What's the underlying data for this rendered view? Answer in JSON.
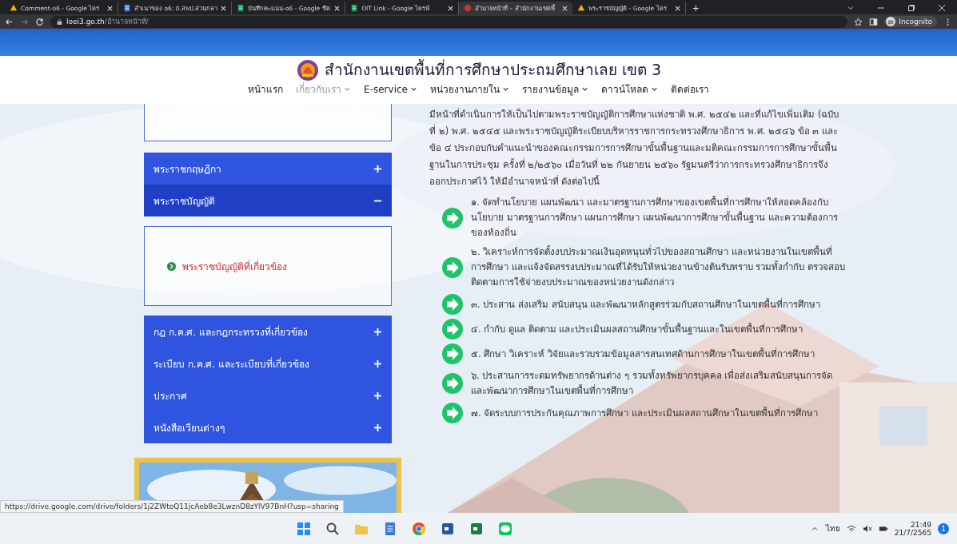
{
  "browser": {
    "tabs": [
      {
        "title": "Comment-o6 - Google ไดร",
        "kind": "drive",
        "selected": false
      },
      {
        "title": "สำเนาของ o6: 0.สพป.ส่วนกลา",
        "kind": "docs",
        "selected": false
      },
      {
        "title": "บันทึกคะแนน-o6 - Google ชีต",
        "kind": "sheets",
        "selected": false
      },
      {
        "title": "OIT Link - Google ไดรฟ์",
        "kind": "sheets",
        "selected": false
      },
      {
        "title": "อำนาจหน้าที่ – สำนักงานเขตพื้",
        "kind": "site",
        "selected": true
      },
      {
        "title": "พระราชบัญญัติ - Google ไดร",
        "kind": "drive",
        "selected": false
      }
    ],
    "new_tab": "+",
    "address": {
      "host": "loei3.go.th",
      "path": "/อำนาจหน้าที่/"
    },
    "profile": "Incognito",
    "status_url": "https://drive.google.com/drive/folders/1j2ZWtoQ11jcAeb8e3LwznD8zYlV97BnH?usp=sharing"
  },
  "site": {
    "title": "สำนักงานเขตพื้นที่การศึกษาประถมศึกษาเลย เขต 3",
    "nav": [
      {
        "label": "หน้าแรก",
        "selected": false,
        "dropdown": false
      },
      {
        "label": "เกี่ยวกับเรา",
        "selected": true,
        "dropdown": true
      },
      {
        "label": "E-service",
        "selected": false,
        "dropdown": true
      },
      {
        "label": "หน่วยงานภายใน",
        "selected": false,
        "dropdown": true
      },
      {
        "label": "รายงานข้อมูล",
        "selected": false,
        "dropdown": true
      },
      {
        "label": "ดาวน์โหลด",
        "selected": false,
        "dropdown": true
      },
      {
        "label": "ติดต่อเรา",
        "selected": false,
        "dropdown": false
      }
    ]
  },
  "sidebar": {
    "items": [
      {
        "label": "พระราชกฤษฎีกา",
        "expanded": false
      },
      {
        "label": "พระราชบัญญัติ",
        "expanded": true,
        "children": [
          {
            "label": "พระราชบัญญัติที่เกี่ยวข้อง"
          }
        ]
      },
      {
        "label": "กฎ ก.ค.ศ. และกฎกระทรวงที่เกี่ยวข้อง",
        "expanded": false
      },
      {
        "label": "ระเบียบ ก.ค.ศ. และระเบียบที่เกี่ยวข้อง",
        "expanded": false
      },
      {
        "label": "ประกาศ",
        "expanded": false
      },
      {
        "label": "หนังสือเวียนต่างๆ",
        "expanded": false
      }
    ]
  },
  "content": {
    "intro": "มีหน้าที่ดำเนินการให้เป็นไปตามพระราชบัญญัติการศึกษาแห่งชาติ พ.ศ. ๒๕๔๒ และที่แก้ไขเพิ่มเติม (ฉบับที่ ๒) พ.ศ. ๒๕๔๕ และพระราชบัญญัติระเบียบบริหารราชการกระทรวงศึกษาธิการ พ.ศ. ๒๕๔๖ ข้อ ๓ และข้อ ๔ ประกอบกับคำแนะนำของคณะกรรมการการศึกษาขั้นพื้นฐานและมติคณะกรรมการการศึกษาขั้นพื้นฐานในการประชุม ครั้งที่ ๒/๒๕๖๐ เมื่อวันที่ ๒๒ กันยายน ๒๕๖๐ รัฐมนตรีว่าการกระทรวงศึกษาธิการจึงออกประกาศไว้ ให้มีอำนาจหน้าที่ ดังต่อไปนี้",
    "duties": [
      "๑. จัดทำนโยบาย แผนพัฒนา และมาตรฐานการศึกษาของเขตพื้นที่การศึกษาให้สอดคล้องกับนโยบาย มาตรฐานการศึกษา แผนการศึกษา แผนพัฒนาการศึกษาขั้นพื้นฐาน และความต้องการของท้องถิ่น",
      "๒. วิเคราะห์การจัดตั้งงบประมาณเงินอุดหนุนทั่วไปของสถานศึกษา และหน่วยงานในเขตพื้นที่การศึกษา และแจ้งจัดสรรงบประมาณที่ได้รับให้หน่วยงานข้างต้นรับทราบ รวมทั้งกำกับ ตรวจสอบ ติดตามการใช้จ่ายงบประมาณของหน่วยงานดังกล่าว",
      "๓. ประสาน ส่งเสริม สนับสนุน และพัฒนาหลักสูตรร่วมกับสถานศึกษาในเขตพื้นที่การศึกษา",
      "๔. กำกับ ดูแล ติดตาม และประเมินผลสถานศึกษาขั้นพื้นฐานและในเขตพื้นที่การศึกษา",
      "๕. ศึกษา วิเคราะห์ วิจัยและรวบรวมข้อมูลสารสนเทศด้านการศึกษาในเขตพื้นที่การศึกษา",
      "๖. ประสานการระดมทรัพยากรด้านต่าง ๆ รวมทั้งทรัพยากรบุคคล เพื่อส่งเสริมสนับสนุนการจัดและพัฒนาการศึกษาในเขตพื้นที่การศึกษา",
      "๗. จัดระบบการประกันคุณภาพการศึกษา และประเมินผลสถานศึกษาในเขตพื้นที่การศึกษา"
    ]
  },
  "taskbar": {
    "apps": [
      {
        "kind": "start"
      },
      {
        "kind": "search"
      },
      {
        "kind": "files"
      },
      {
        "kind": "notepad"
      },
      {
        "kind": "chrome"
      },
      {
        "kind": "word"
      },
      {
        "kind": "excel"
      },
      {
        "kind": "line"
      }
    ],
    "language": "ไทย",
    "time": "21:49",
    "date": "21/7/2565",
    "notifications": "1"
  }
}
